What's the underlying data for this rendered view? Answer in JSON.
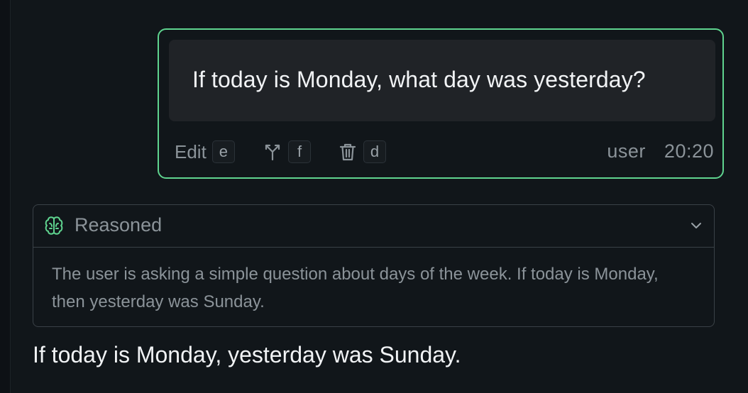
{
  "user_message": {
    "text": "If today is Monday, what day was yesterday?",
    "actions": {
      "edit_label": "Edit",
      "edit_key": "e",
      "fork_icon": "branch-icon",
      "fork_key": "f",
      "delete_icon": "trash-icon",
      "delete_key": "d"
    },
    "role": "user",
    "time": "20:20"
  },
  "reasoning": {
    "label": "Reasoned",
    "icon": "brain-icon",
    "text": "The user is asking a simple question about days of the week. If today is Monday, then yesterday was Sunday."
  },
  "assistant_message": {
    "text": "If today is Monday, yesterday was Sunday."
  },
  "colors": {
    "accent": "#5fd48f",
    "background": "#11161a",
    "bubble": "#202327",
    "muted_text": "#8b9399"
  }
}
